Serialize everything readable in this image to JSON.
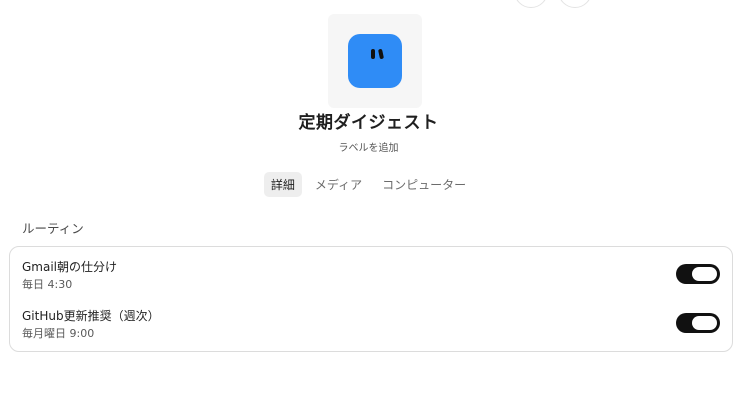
{
  "header": {
    "title": "定期ダイジェスト",
    "add_label": "ラベルを追加"
  },
  "avatar": {
    "color": "#2f8cf6",
    "icon": "blue-square-face-icon"
  },
  "tabs": [
    {
      "label": "詳細",
      "active": true
    },
    {
      "label": "メディア",
      "active": false
    },
    {
      "label": "コンピューター",
      "active": false
    }
  ],
  "routines": {
    "section_label": "ルーティン",
    "items": [
      {
        "name": "Gmail朝の仕分け",
        "schedule": "毎日 4:30",
        "enabled": true
      },
      {
        "name": "GitHub更新推奨（週次）",
        "schedule": "毎月曜日 9:00",
        "enabled": true
      }
    ]
  },
  "colors": {
    "toggle_on": "#111111",
    "avatar": "#2f8cf6"
  }
}
